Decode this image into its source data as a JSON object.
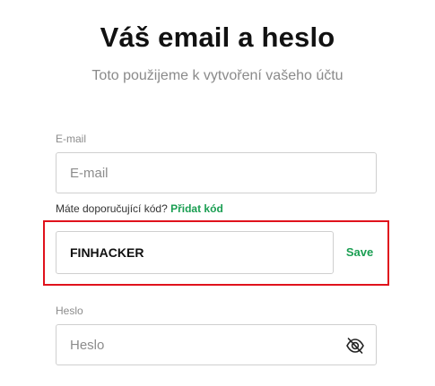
{
  "header": {
    "title": "Váš email a heslo",
    "subtitle": "Toto použijeme k vytvoření vašeho účtu"
  },
  "email": {
    "label": "E-mail",
    "placeholder": "E-mail",
    "value": ""
  },
  "referral": {
    "question": "Máte doporučující kód?",
    "link_label": "Přidat kód",
    "code_value": "FINHACKER",
    "save_label": "Save"
  },
  "password": {
    "label": "Heslo",
    "placeholder": "Heslo",
    "value": "",
    "toggle_icon": "eye-slash-icon"
  },
  "colors": {
    "accent_green": "#1a9e52",
    "highlight_red": "#e0121c"
  }
}
